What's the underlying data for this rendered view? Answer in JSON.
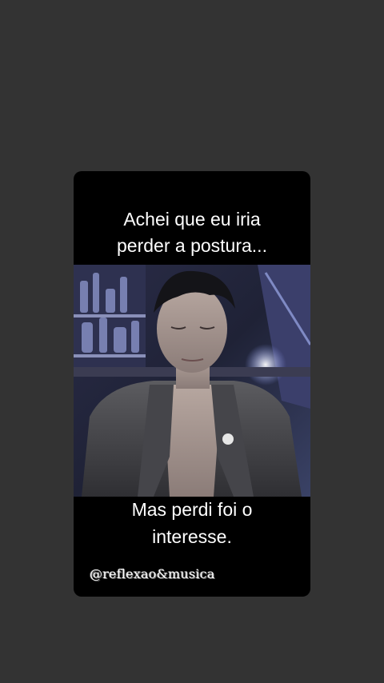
{
  "post": {
    "caption_top": [
      "Achei que eu iria",
      "perder a postura..."
    ],
    "caption_bottom": [
      "Mas perdi foi o",
      "interesse."
    ],
    "watermark": "@reflexao&musica"
  },
  "colors": {
    "screen_background": "#333333",
    "card_background": "#000000",
    "text": "#ffffff"
  },
  "photo": {
    "subject": "man-in-leather-jacket"
  }
}
